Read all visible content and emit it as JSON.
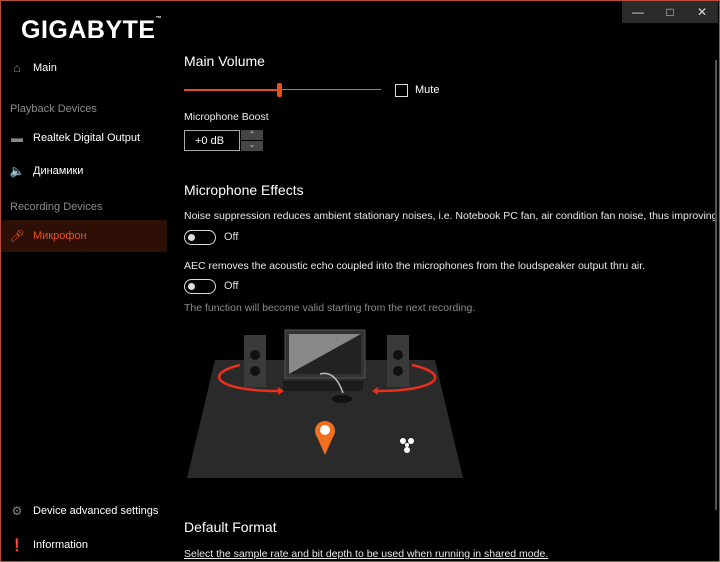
{
  "window": {
    "controls": [
      "minimize",
      "maximize",
      "close"
    ]
  },
  "logo": "GIGABYTE",
  "sidebar": {
    "main": "Main",
    "playback_section": "Playback Devices",
    "playback": [
      "Realtek Digital Output",
      "Динамики"
    ],
    "recording_section": "Recording Devices",
    "recording": [
      "Микрофон"
    ],
    "advanced": "Device advanced settings",
    "information": "Information"
  },
  "main": {
    "volume_title": "Main Volume",
    "volume_percent": 48,
    "mute_label": "Mute",
    "mute_checked": false,
    "boost_label": "Microphone Boost",
    "boost_value": "+0 dB",
    "effects_title": "Microphone Effects",
    "noise_desc": "Noise suppression reduces ambient stationary noises, i.e. Notebook PC fan, air condition fan noise, thus improving s",
    "noise_state": "Off",
    "aec_desc": "AEC removes the acoustic echo coupled into the microphones from the loudspeaker output thru air.",
    "aec_state": "Off",
    "note": "The function will become valid starting from the next recording.",
    "format_title": "Default Format",
    "format_desc": "Select the sample rate and bit depth to be used when running in shared mode."
  },
  "colors": {
    "accent": "#e8501c",
    "border": "#b5503c"
  }
}
